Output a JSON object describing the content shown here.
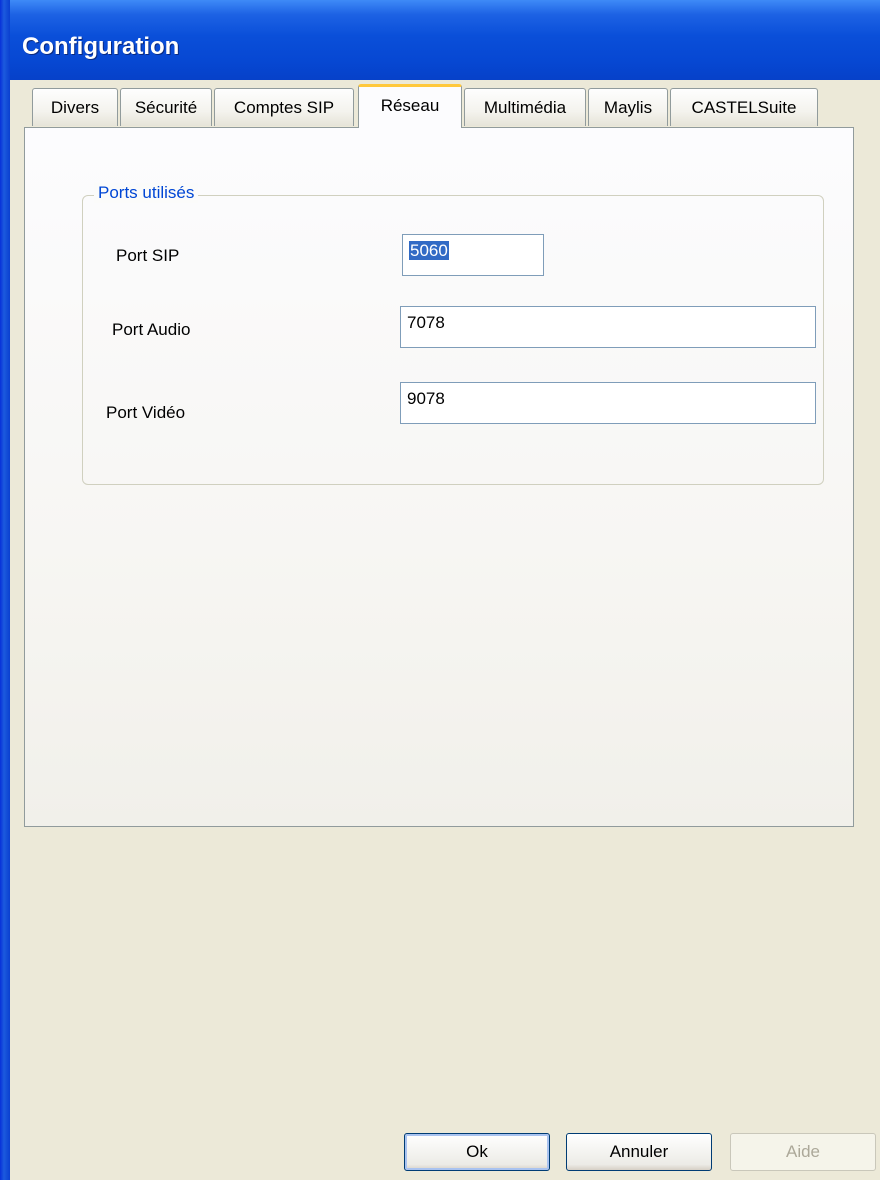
{
  "window": {
    "title": "Configuration"
  },
  "tabs": [
    {
      "label": "Divers",
      "active": false
    },
    {
      "label": "Sécurité",
      "active": false
    },
    {
      "label": "Comptes SIP",
      "active": false
    },
    {
      "label": "Réseau",
      "active": true
    },
    {
      "label": "Multimédia",
      "active": false
    },
    {
      "label": "Maylis",
      "active": false
    },
    {
      "label": "CASTELSuite",
      "active": false
    }
  ],
  "ports_group": {
    "title": "Ports utilisés",
    "sip_label": "Port SIP",
    "sip_value": "5060",
    "audio_label": "Port Audio",
    "audio_value": "7078",
    "video_label": "Port Vidéo",
    "video_value": "9078"
  },
  "buttons": {
    "ok": "Ok",
    "cancel": "Annuler",
    "help": "Aide"
  }
}
